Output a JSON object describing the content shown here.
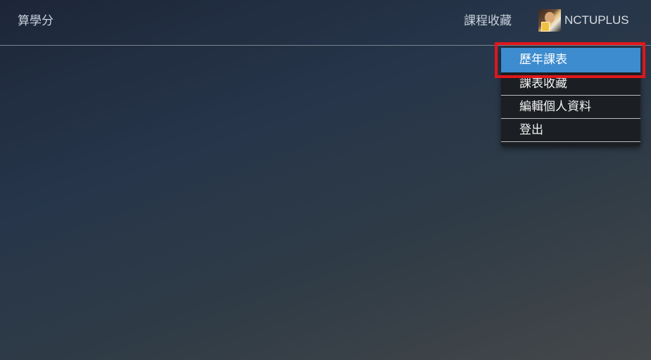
{
  "navbar": {
    "brand": "算學分",
    "course_favorites": "課程收藏",
    "user_name": "NCTUPLUS"
  },
  "dropdown": {
    "items": [
      {
        "label": "歷年課表",
        "active": true
      },
      {
        "label": "課表收藏",
        "active": false
      },
      {
        "label": "編輯個人資料",
        "active": false
      },
      {
        "label": "登出",
        "active": false
      }
    ]
  },
  "colors": {
    "active_item": "#3d8ccf",
    "highlight_box": "#e0161b",
    "dropdown_bg": "#1b1e22"
  }
}
